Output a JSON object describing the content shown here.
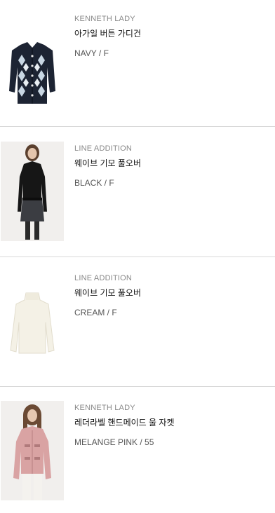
{
  "items": [
    {
      "brand": "KENNETH LADY",
      "name": "아가일 버튼 가디건",
      "option": "NAVY / F",
      "icon": "navy-argyle-cardigan"
    },
    {
      "brand": "LINE ADDITION",
      "name": "웨이브 기모 풀오버",
      "option": "BLACK / F",
      "icon": "black-pullover-model"
    },
    {
      "brand": "LINE ADDITION",
      "name": "웨이브 기모 풀오버",
      "option": "CREAM / F",
      "icon": "cream-pullover"
    },
    {
      "brand": "KENNETH LADY",
      "name": "레더라벨 핸드메이드 울 자켓",
      "option": "MELANGE PINK / 55",
      "icon": "pink-wool-jacket-model"
    }
  ],
  "colors": {
    "divider": "#d9d9d9",
    "brand_text": "#888888",
    "option_text": "#555555"
  }
}
